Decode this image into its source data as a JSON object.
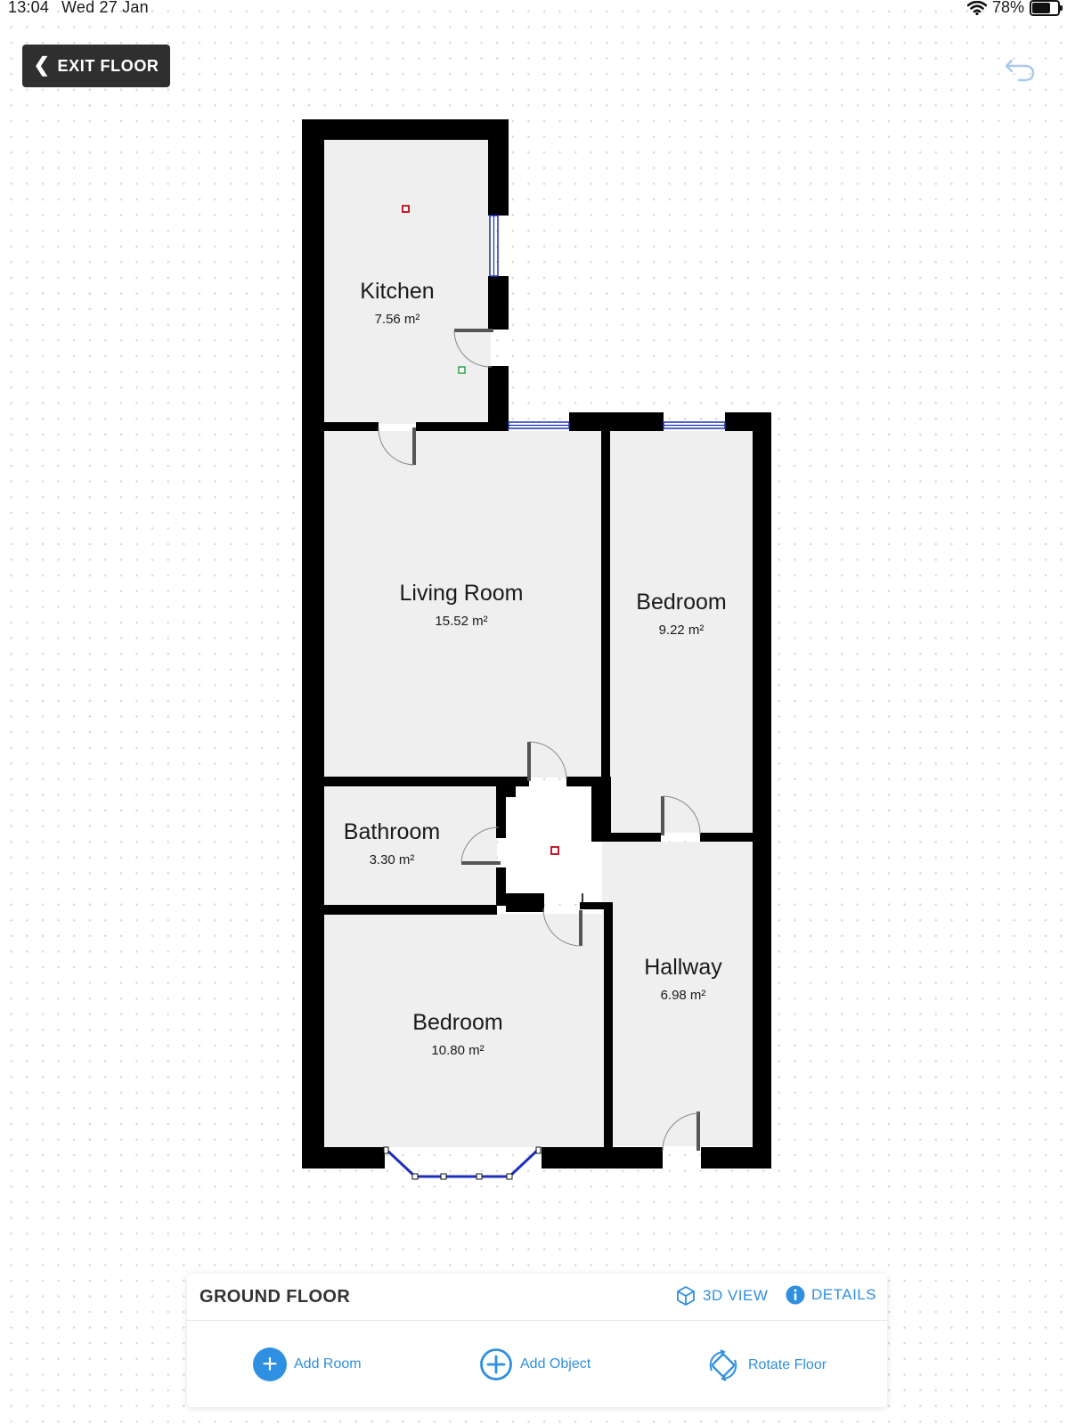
{
  "status_bar": {
    "time": "13:04",
    "date": "Wed 27 Jan",
    "battery": "78%",
    "battery_level": 0.78
  },
  "header": {
    "exit_label": "EXIT FLOOR"
  },
  "rooms": [
    {
      "name": "Kitchen",
      "area": "7.56 m²"
    },
    {
      "name": "Living Room",
      "area": "15.52 m²"
    },
    {
      "name": "Bedroom",
      "area": "9.22 m²"
    },
    {
      "name": "Bathroom",
      "area": "3.30 m²"
    },
    {
      "name": "Hallway",
      "area": "6.98 m²"
    },
    {
      "name": "Bedroom",
      "area": "10.80 m²"
    }
  ],
  "panel": {
    "title": "GROUND FLOOR",
    "view3d_label": "3D VIEW",
    "details_label": "DETAILS",
    "add_room_label": "Add Room",
    "add_object_label": "Add Object",
    "rotate_floor_label": "Rotate Floor"
  },
  "colors": {
    "accent": "#2f8fe0",
    "wall": "#000000",
    "room_fill": "#efefef",
    "window": "#1c2fbf"
  }
}
